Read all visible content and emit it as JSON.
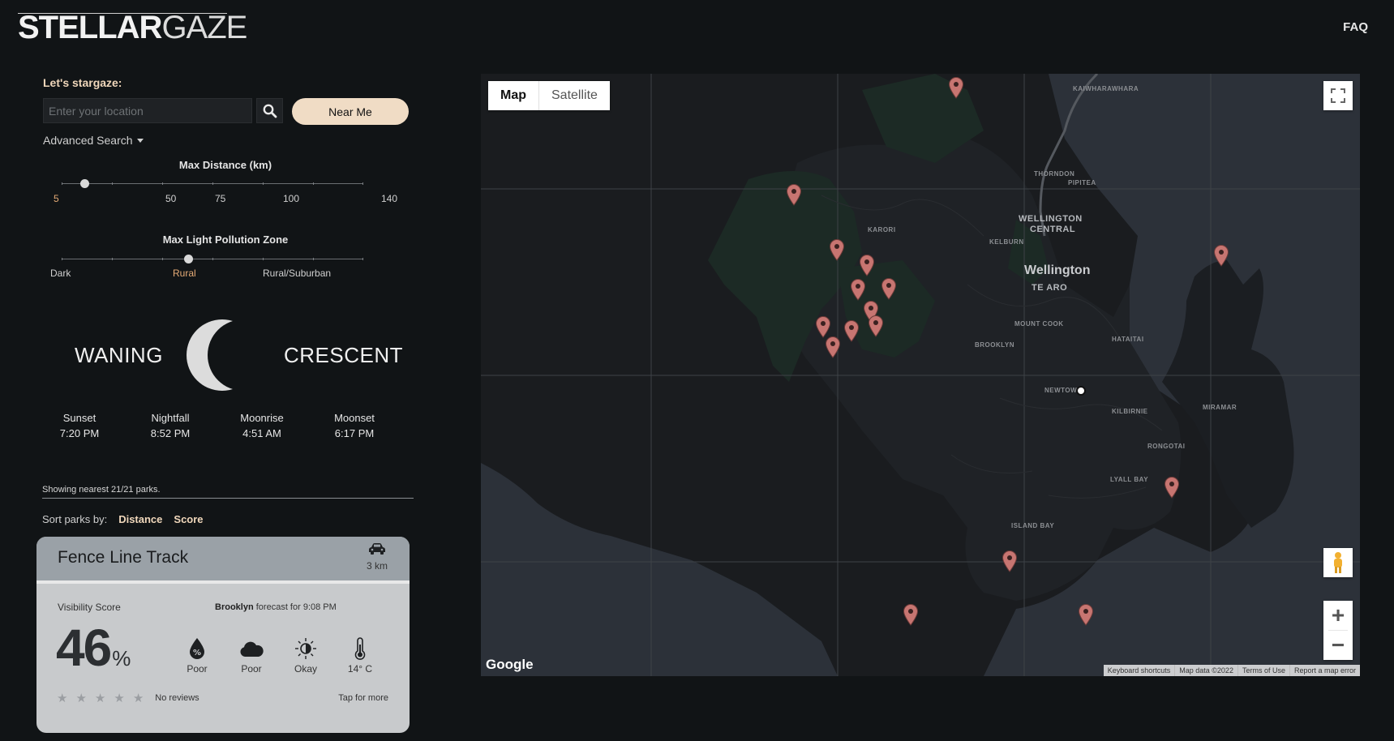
{
  "header": {
    "logo_bold": "STELLAR",
    "logo_thin": "GAZE",
    "faq": "FAQ"
  },
  "search": {
    "title": "Let's stargaze:",
    "placeholder": "Enter your location",
    "search_icon": "search-icon",
    "near_me": "Near Me",
    "advanced": "Advanced Search"
  },
  "distance_slider": {
    "title": "Max Distance (km)",
    "labels": [
      "5",
      "50",
      "75",
      "100",
      "140"
    ],
    "value_km": 5
  },
  "light_slider": {
    "title": "Max Light Pollution Zone",
    "labels": [
      "Dark",
      "Rural",
      "Rural/Suburban"
    ],
    "selected": "Rural"
  },
  "moon": {
    "word1": "WANING",
    "word2": "CRESCENT",
    "icon": "moon-crescent-icon"
  },
  "times": [
    {
      "label": "Sunset",
      "value": "7:20 PM"
    },
    {
      "label": "Nightfall",
      "value": "8:52 PM"
    },
    {
      "label": "Moonrise",
      "value": "4:51 AM"
    },
    {
      "label": "Moonset",
      "value": "6:17 PM"
    }
  ],
  "results": {
    "showing": "Showing nearest 21/21 parks.",
    "sort_label": "Sort parks by:",
    "sort_options": [
      "Distance",
      "Score"
    ]
  },
  "park_card": {
    "name": "Fence Line Track",
    "distance": "3 km",
    "car_icon": "car-icon",
    "visibility_label": "Visibility Score",
    "forecast_place": "Brooklyn",
    "forecast_text": " forecast for 9:08 PM",
    "score": "46",
    "score_unit": "%",
    "weather": [
      {
        "icon": "humidity-icon",
        "value": "Poor"
      },
      {
        "icon": "cloud-icon",
        "value": "Poor"
      },
      {
        "icon": "moon-phase-icon",
        "value": "Okay"
      },
      {
        "icon": "thermometer-icon",
        "value": "14° C"
      }
    ],
    "rating_stars": 0,
    "reviews": "No reviews",
    "tap_more": "Tap for more"
  },
  "map": {
    "type_map": "Map",
    "type_satellite": "Satellite",
    "labels": [
      "KAIWHARAWHARA",
      "THORNDON",
      "PIPITEA",
      "WELLINGTON",
      "CENTRAL",
      "KARORI",
      "KELBURN",
      "TE ARO",
      "MOUNT COOK",
      "BROOKLYN",
      "HATAITAI",
      "NEWTOWN",
      "KILBIRNIE",
      "MIRAMAR",
      "RONGOTAI",
      "LYALL BAY",
      "ISLAND BAY"
    ],
    "city": "Wellington",
    "google": "Google",
    "attribution": [
      "Keyboard shortcuts",
      "Map data ©2022",
      "Terms of Use",
      "Report a map error"
    ],
    "pin_color": "#c77571"
  }
}
